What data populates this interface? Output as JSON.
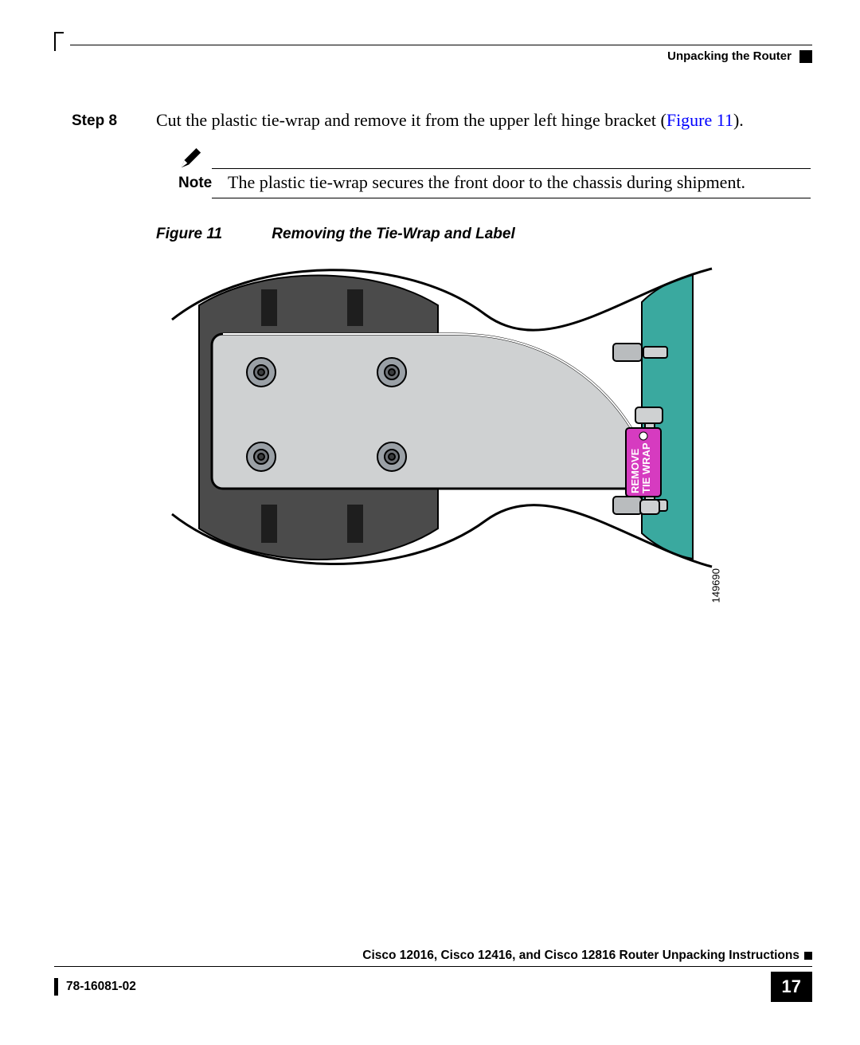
{
  "header": {
    "section": "Unpacking the Router"
  },
  "body": {
    "step_label": "Step 8",
    "step_text_a": "Cut the plastic tie-wrap and remove it from the upper left hinge bracket (",
    "step_xref": "Figure 11",
    "step_text_b": ").",
    "note_label": "Note",
    "note_text": "The plastic tie-wrap secures the front door to the chassis during shipment.",
    "figure_label": "Figure 11",
    "figure_title": "Removing the Tie-Wrap and Label",
    "tag_remove": "REMOVE",
    "tag_tiewrap": "TIE WRAP",
    "diagram_number": "149690"
  },
  "footer": {
    "doc_title": "Cisco 12016, Cisco 12416, and Cisco 12816 Router Unpacking Instructions",
    "doc_code": "78-16081-02",
    "page_number": "17"
  }
}
